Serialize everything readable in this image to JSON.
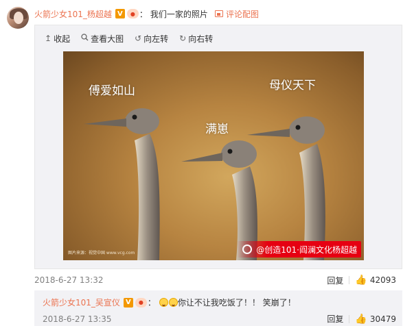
{
  "post": {
    "username": "火箭少女101_杨超越",
    "verified_badge": "V",
    "medal_badge": "🥇",
    "text": "我们一家的照片",
    "comment_pic_label": "评论配图",
    "timestamp": "2018-6-27 13:32",
    "reply_label": "回复",
    "like_count": "42093"
  },
  "toolbar": {
    "collapse_label": "收起",
    "view_large_label": "查看大图",
    "rotate_left_label": "向左转",
    "rotate_right_label": "向右转"
  },
  "photo": {
    "captions": {
      "left": "傅爱如山",
      "middle": "满崽",
      "right": "母仪天下"
    },
    "credit": "图片来源：视觉中国 www.vcg.com",
    "watermark": "@创造101·阎澜文化杨超越"
  },
  "reply": {
    "username": "火箭少女101_吴宣仪",
    "verified_badge": "V",
    "medal_badge": "🥇",
    "text": "你让不让我吃饭了！！ 笑崩了！",
    "timestamp": "2018-6-27 13:35",
    "reply_label": "回复",
    "like_count": "30479"
  },
  "icons": {
    "collapse": "↥",
    "view_large": "🔍",
    "rotate_left": "↺",
    "rotate_right": "↻",
    "like": "👍"
  },
  "colors": {
    "accent": "#eb7350",
    "badge": "#f39800",
    "watermark": "#e60012",
    "panel": "#f2f2f5"
  }
}
